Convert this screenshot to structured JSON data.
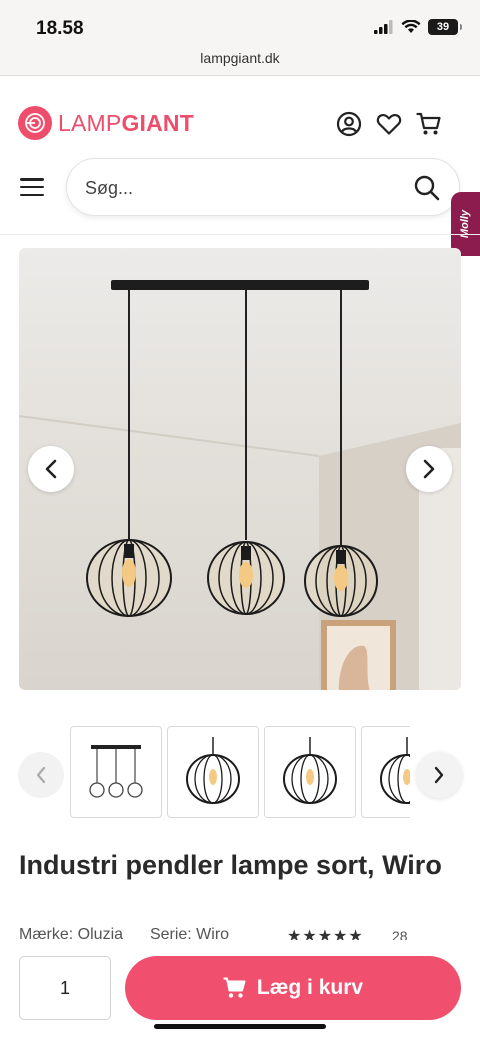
{
  "status_bar": {
    "time": "18.58",
    "battery": "39"
  },
  "browser": {
    "url": "lampgiant.dk"
  },
  "header": {
    "logo_part1": "LAMP",
    "logo_part2": "GIANT",
    "search_placeholder": "Søg...",
    "side_tab": "Molly"
  },
  "gallery": {
    "thumbnail_count": 4
  },
  "product": {
    "title": "Industri pendler lampe sort, Wiro",
    "brand_label": "Mærke: Oluzia",
    "series_label": "Serie: Wiro",
    "rating_stars": "★★★★★",
    "review_count": "28"
  },
  "purchase": {
    "quantity": "1",
    "add_to_cart_label": "Læg i kurv"
  },
  "colors": {
    "brand": "#ee4e6b",
    "cart_button": "#f0506e",
    "side_tab": "#8b1c4d"
  }
}
